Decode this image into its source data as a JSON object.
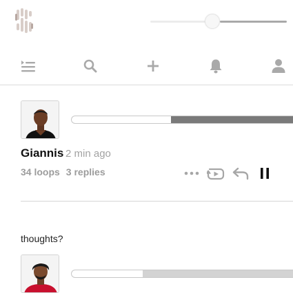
{
  "header": {
    "logo_icon": "s-logo-icon",
    "volume_level": 0.45
  },
  "nav": {
    "items": [
      {
        "icon": "queue-list-icon"
      },
      {
        "icon": "search-icon"
      },
      {
        "icon": "plus-icon"
      },
      {
        "icon": "bell-icon"
      },
      {
        "icon": "user-icon"
      }
    ]
  },
  "posts": [
    {
      "author": "Giannis",
      "time": "2 min ago",
      "loops": "34 loops",
      "replies": "3 replies",
      "progress": 0.55,
      "progress_color": "#7a7a7a",
      "actions": [
        "more-icon",
        "loop-icon",
        "reply-icon",
        "pause-icon"
      ]
    },
    {
      "text": "thoughts?",
      "progress": 0.68,
      "progress_color": "#d3d3d3"
    }
  ]
}
